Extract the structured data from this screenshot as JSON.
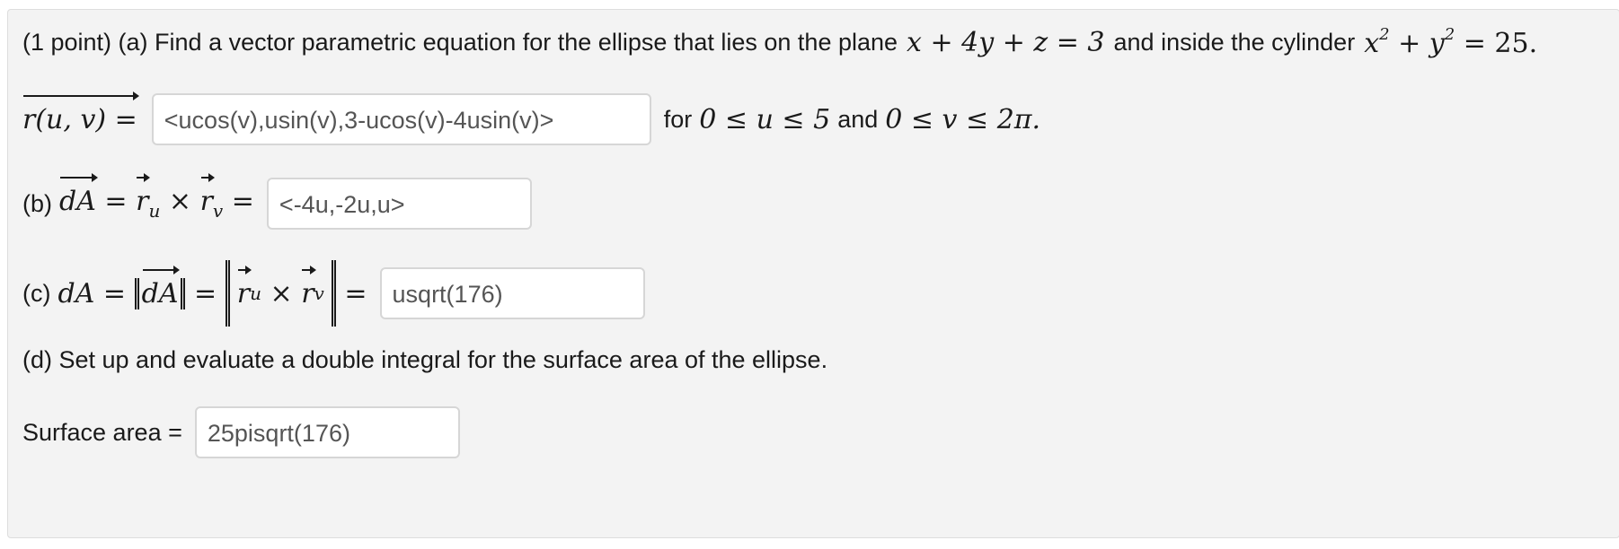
{
  "part_a": {
    "intro": "(1 point) (a) Find a vector parametric equation for the ellipse that lies on the plane",
    "plane": "x + 4y + z = 3",
    "mid": "and inside the cylinder",
    "cyl_x": "x",
    "cyl_y": "y",
    "cyl_exp": "2",
    "cyl_rhs": "= 25.",
    "r_label": "r(u, v) =",
    "answer": "<ucos(v),usin(v),3-ucos(v)-4usin(v)>",
    "for": "for",
    "u_range": "0 ≤ u ≤ 5",
    "and": "and",
    "v_range": "0 ≤ v ≤ 2π."
  },
  "part_b": {
    "label": "(b)",
    "dA": "dA",
    "answer": "<-4u,-2u,u>"
  },
  "part_c": {
    "label": "(c)",
    "answer": "usqrt(176)"
  },
  "part_d": {
    "prompt": "(d) Set up and evaluate a double integral for the surface area of the ellipse.",
    "label": "Surface area =",
    "answer": "25pisqrt(176)"
  }
}
